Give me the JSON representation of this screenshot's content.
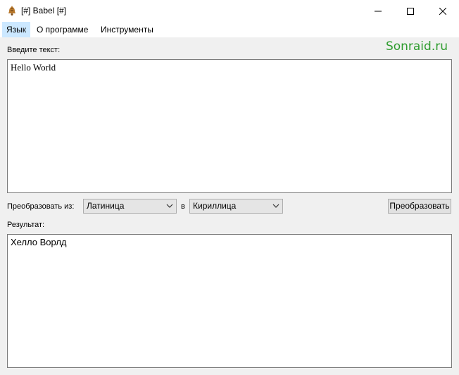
{
  "window": {
    "title": "[#] Babel [#]",
    "icon": "bell-icon"
  },
  "menu": {
    "items": [
      "Язык",
      "О программе",
      "Инструменты"
    ]
  },
  "brand": "Sonraid.ru",
  "input": {
    "label": "Введите текст:",
    "value": "Hello World"
  },
  "convert": {
    "from_label": "Преобразовать из:",
    "from_value": "Латиница",
    "to_label": "в",
    "to_value": "Кириллица",
    "button": "Преобразовать"
  },
  "output": {
    "label": "Результат:",
    "value": "Хелло Ворлд"
  },
  "colors": {
    "brand": "#2e9c2e",
    "menu_active": "#cce8ff"
  }
}
